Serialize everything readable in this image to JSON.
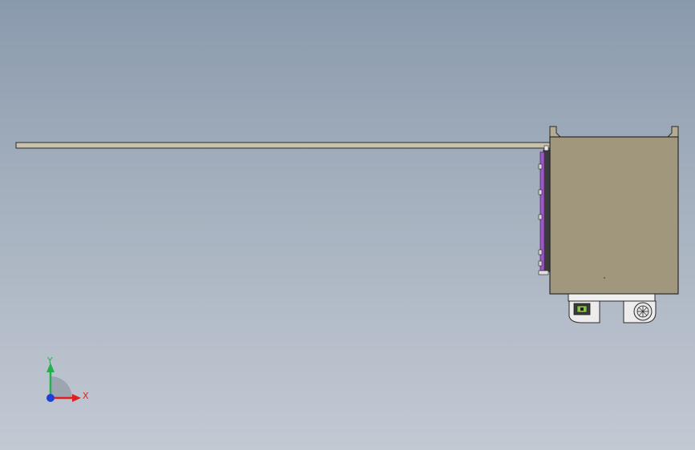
{
  "viewport": {
    "background_top": "#8a9aad",
    "background_bottom": "#c2c9d3"
  },
  "model": {
    "body_color": "#a1977d",
    "outline_color": "#2a2a2a",
    "panel_color": "#9b59c4",
    "rail_color": "#c8c1ac"
  },
  "triad": {
    "x_label": "X",
    "y_label": "Y",
    "x_color": "#e02020",
    "y_color": "#22b14c",
    "z_color": "#1f3fd6"
  }
}
